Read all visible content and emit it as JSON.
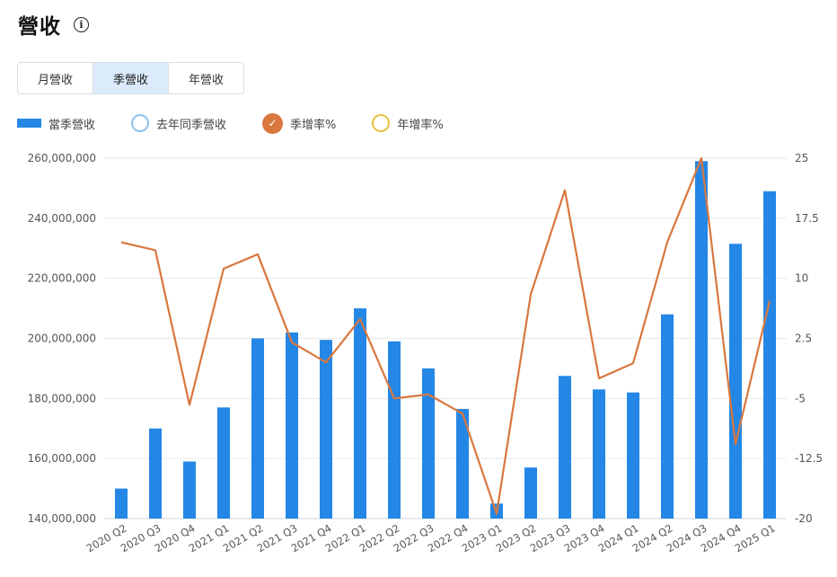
{
  "header": {
    "title": "營收"
  },
  "tabs": [
    {
      "label": "月營收",
      "active": false
    },
    {
      "label": "季營收",
      "active": true
    },
    {
      "label": "年營收",
      "active": false
    }
  ],
  "legend": {
    "current_quarter": "當季營收",
    "last_year_quarter": "去年同季營收",
    "qoq_rate": "季增率%",
    "yoy_rate": "年增率%"
  },
  "colors": {
    "bar": "#2487e6",
    "qoq_line": "#d9773f",
    "yoy": "#e8c13d",
    "last_year": "#8cc3ef"
  },
  "chart_data": {
    "type": "bar",
    "categories": [
      "2020 Q2",
      "2020 Q3",
      "2020 Q4",
      "2021 Q1",
      "2021 Q2",
      "2021 Q3",
      "2021 Q4",
      "2022 Q1",
      "2022 Q2",
      "2022 Q3",
      "2022 Q4",
      "2023 Q1",
      "2023 Q2",
      "2023 Q3",
      "2023 Q4",
      "2024 Q1",
      "2024 Q2",
      "2024 Q3",
      "2024 Q4",
      "2025 Q1"
    ],
    "series": [
      {
        "name": "當季營收",
        "type": "bar",
        "axis": "left",
        "values": [
          150000000,
          170000000,
          159000000,
          177000000,
          200000000,
          202000000,
          199500000,
          210000000,
          199000000,
          190000000,
          176500000,
          145000000,
          157000000,
          187500000,
          183000000,
          182000000,
          208000000,
          259000000,
          231500000,
          249000000
        ]
      },
      {
        "name": "季增率%",
        "type": "line",
        "axis": "right",
        "values": [
          14.5,
          13.5,
          -5.8,
          11.2,
          13.0,
          2.0,
          -0.5,
          4.9,
          -5.0,
          -4.5,
          -6.9,
          -19.4,
          8.0,
          21.0,
          -2.5,
          -0.6,
          14.5,
          25.0,
          -10.7,
          7.2
        ]
      }
    ],
    "y_left": {
      "min": 140000000,
      "max": 260000000,
      "ticks": [
        "140,000,000",
        "160,000,000",
        "180,000,000",
        "200,000,000",
        "220,000,000",
        "240,000,000",
        "260,000,000"
      ]
    },
    "y_right": {
      "min": -20,
      "max": 25,
      "ticks": [
        "-20",
        "-12.5",
        "-5",
        "2.5",
        "10",
        "17.5",
        "25"
      ]
    },
    "grid": true,
    "legend_position": "top-left"
  }
}
